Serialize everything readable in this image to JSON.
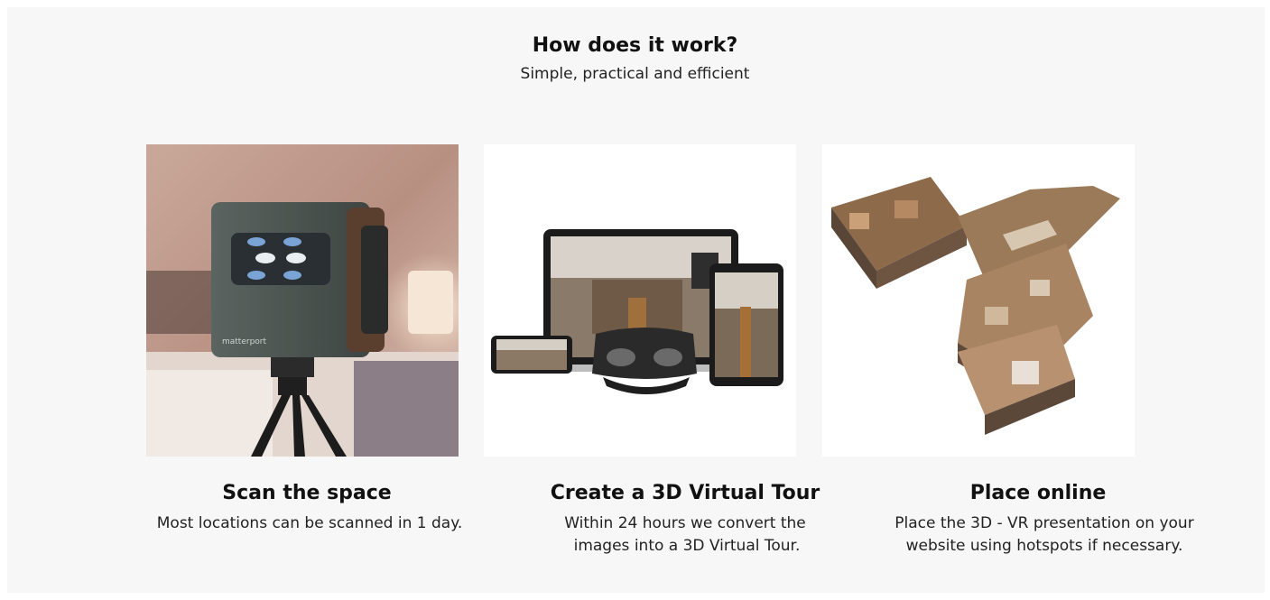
{
  "header": {
    "title": "How does it work?",
    "subtitle": "Simple, practical and efficient"
  },
  "steps": [
    {
      "title": "Scan the space",
      "description": "Most locations can be scanned in 1 day.",
      "image_icon": "matterport-camera-photo",
      "camera_brand": "matterport"
    },
    {
      "title": "Create a 3D Virtual Tour",
      "description_line1": "Within 24 hours we convert the",
      "description_line2": "images into a 3D Virtual Tour.",
      "image_icon": "devices-vr-photo"
    },
    {
      "title": "Place online",
      "description_line1": "Place the 3D - VR presentation on your",
      "description_line2": "website using hotspots if necessary.",
      "image_icon": "dollhouse-floorplan-photo"
    }
  ],
  "colors": {
    "panel_bg": "#f7f7f7",
    "text": "#111111"
  }
}
